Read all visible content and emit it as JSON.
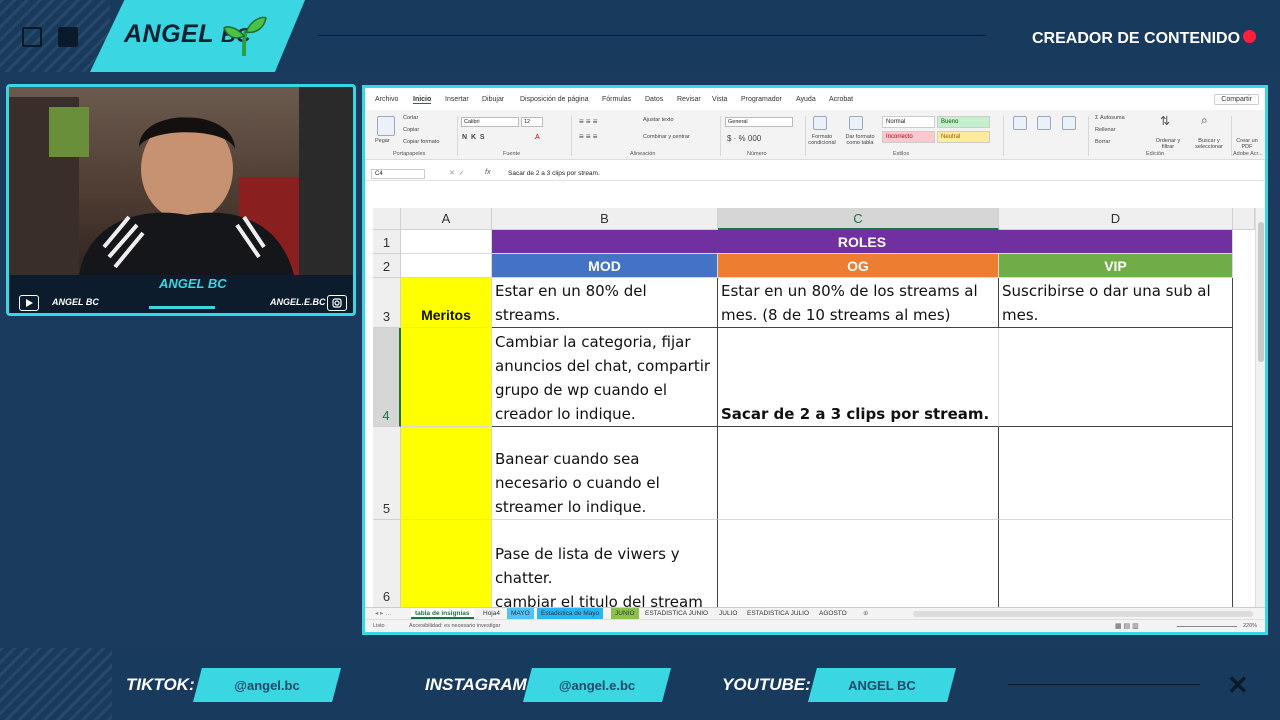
{
  "header": {
    "logo_name": "ANGEL",
    "logo_suffix": "BC",
    "creator_label": "CREADOR DE CONTENIDO"
  },
  "webcam": {
    "name": "ANGEL BC",
    "youtube_handle": "ANGEL BC",
    "instagram_handle": "ANGEL.E.BC"
  },
  "excel": {
    "ribbon_tabs": [
      "Archivo",
      "Inicio",
      "Insertar",
      "Dibujar",
      "Disposición de página",
      "Fórmulas",
      "Datos",
      "Revisar",
      "Vista",
      "Programador",
      "Ayuda",
      "Acrobat"
    ],
    "active_tab": "Inicio",
    "share_label": "Compartir",
    "clipboard": {
      "cut": "Cortar",
      "copy": "Copiar",
      "format_painter": "Copiar formato",
      "paste": "Pegar",
      "group": "Portapapeles"
    },
    "font": {
      "name": "Calibri",
      "size": "12",
      "group": "Fuente"
    },
    "alignment": {
      "wrap": "Ajustar texto",
      "merge": "Combinar y centrar",
      "group": "Alineación"
    },
    "number": {
      "format": "General",
      "group": "Número"
    },
    "styles": {
      "conditional": "Formato condicional",
      "as_table": "Dar formato como tabla",
      "normal": "Normal",
      "good": "Bueno",
      "bad": "Incorrecto",
      "neutral": "Neutral",
      "group": "Estilos"
    },
    "cells": {
      "roles": "ROLES",
      "mod": "MOD",
      "og": "OG",
      "vip": "VIP",
      "meritos": "Meritos",
      "b3": "Estar en un 80% del streams.",
      "c3": "Estar en un 80% de los streams al mes. (8 de 10 streams al mes)",
      "d3": "Suscribirse o dar una sub al mes.",
      "b4": "Cambiar la categoria, fijar anuncios del chat, compartir grupo de wp cuando el creador lo indique.",
      "c4": "Sacar de 2 a 3 clips por stream.",
      "b5": "Banear cuando sea necesario o cuando el streamer lo indique.",
      "b6": "Pase de lista de viwers y chatter.\ncambiar el titulo del stream"
    },
    "editing": {
      "autosum": "Autosuma",
      "fill": "Rellenar",
      "clear": "Borrar",
      "sort": "Ordenar y filtrar",
      "find": "Buscar y seleccionar",
      "group": "Edición"
    },
    "pdf": {
      "create": "Crear un PDF",
      "group": "Adobe Acr..."
    },
    "name_box": "C4",
    "formula": "Sacar de 2 a 3 clips por stream.",
    "columns": [
      "A",
      "B",
      "C",
      "D"
    ],
    "rows": [
      "1",
      "2",
      "3",
      "4",
      "5",
      "6"
    ],
    "sheet_tabs": [
      "tabla de insignias",
      "Hoja4",
      "MAYO",
      "Estadistica de Mayo",
      "JUNIO",
      "ESTADISTICA JUNIO",
      "JULIO",
      "ESTADISTICA JULIO",
      "AGOSTO"
    ],
    "status": {
      "ready": "Listo",
      "accessibility": "Accesibilidad: es necesario investigar",
      "zoom": "220%"
    }
  },
  "footer": {
    "tiktok_label": "TIKTOK:",
    "tiktok_handle": "@angel.bc",
    "instagram_label": "INSTAGRAM:",
    "instagram_handle": "@angel.e.bc",
    "youtube_label": "YOUTUBE:",
    "youtube_handle": "ANGEL BC"
  },
  "colors": {
    "accent": "#3ad6e2",
    "roles": "#7030a0",
    "mod": "#4472c4",
    "og": "#ed7d31",
    "vip": "#70ad47",
    "meritos": "#ffff00"
  }
}
